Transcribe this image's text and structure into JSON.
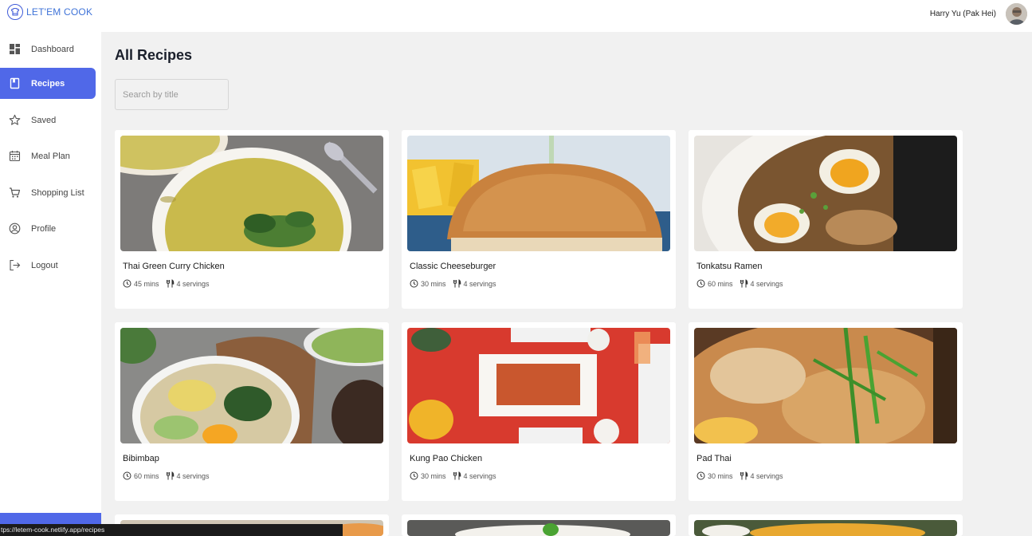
{
  "app": {
    "name": "LET'EM COOK"
  },
  "header": {
    "user_name": "Harry Yu (Pak Hei)"
  },
  "sidebar": {
    "items": [
      {
        "label": "Dashboard",
        "icon": "dashboard-icon",
        "active": false
      },
      {
        "label": "Recipes",
        "icon": "book-icon",
        "active": true
      },
      {
        "label": "Saved",
        "icon": "star-icon",
        "active": false
      },
      {
        "label": "Meal Plan",
        "icon": "calendar-icon",
        "active": false
      },
      {
        "label": "Shopping List",
        "icon": "cart-icon",
        "active": false
      },
      {
        "label": "Profile",
        "icon": "user-icon",
        "active": false
      },
      {
        "label": "Logout",
        "icon": "logout-icon",
        "active": false
      }
    ]
  },
  "main": {
    "title": "All Recipes",
    "search": {
      "placeholder": "Search by title",
      "value": ""
    },
    "recipes": [
      {
        "title": "Thai Green Curry Chicken",
        "time": "45 mins",
        "servings": "4 servings"
      },
      {
        "title": "Classic Cheeseburger",
        "time": "30 mins",
        "servings": "4 servings"
      },
      {
        "title": "Tonkatsu Ramen",
        "time": "60 mins",
        "servings": "4 servings"
      },
      {
        "title": "Bibimbap",
        "time": "60 mins",
        "servings": "4 servings"
      },
      {
        "title": "Kung Pao Chicken",
        "time": "30 mins",
        "servings": "4 servings"
      },
      {
        "title": "Pad Thai",
        "time": "30 mins",
        "servings": "4 servings"
      }
    ]
  },
  "status_bar": {
    "url": "tps://letem-cook.netlify.app/recipes"
  },
  "colors": {
    "accent": "#5068e8",
    "logo": "#3f73d8",
    "background": "#f1f1f1"
  }
}
